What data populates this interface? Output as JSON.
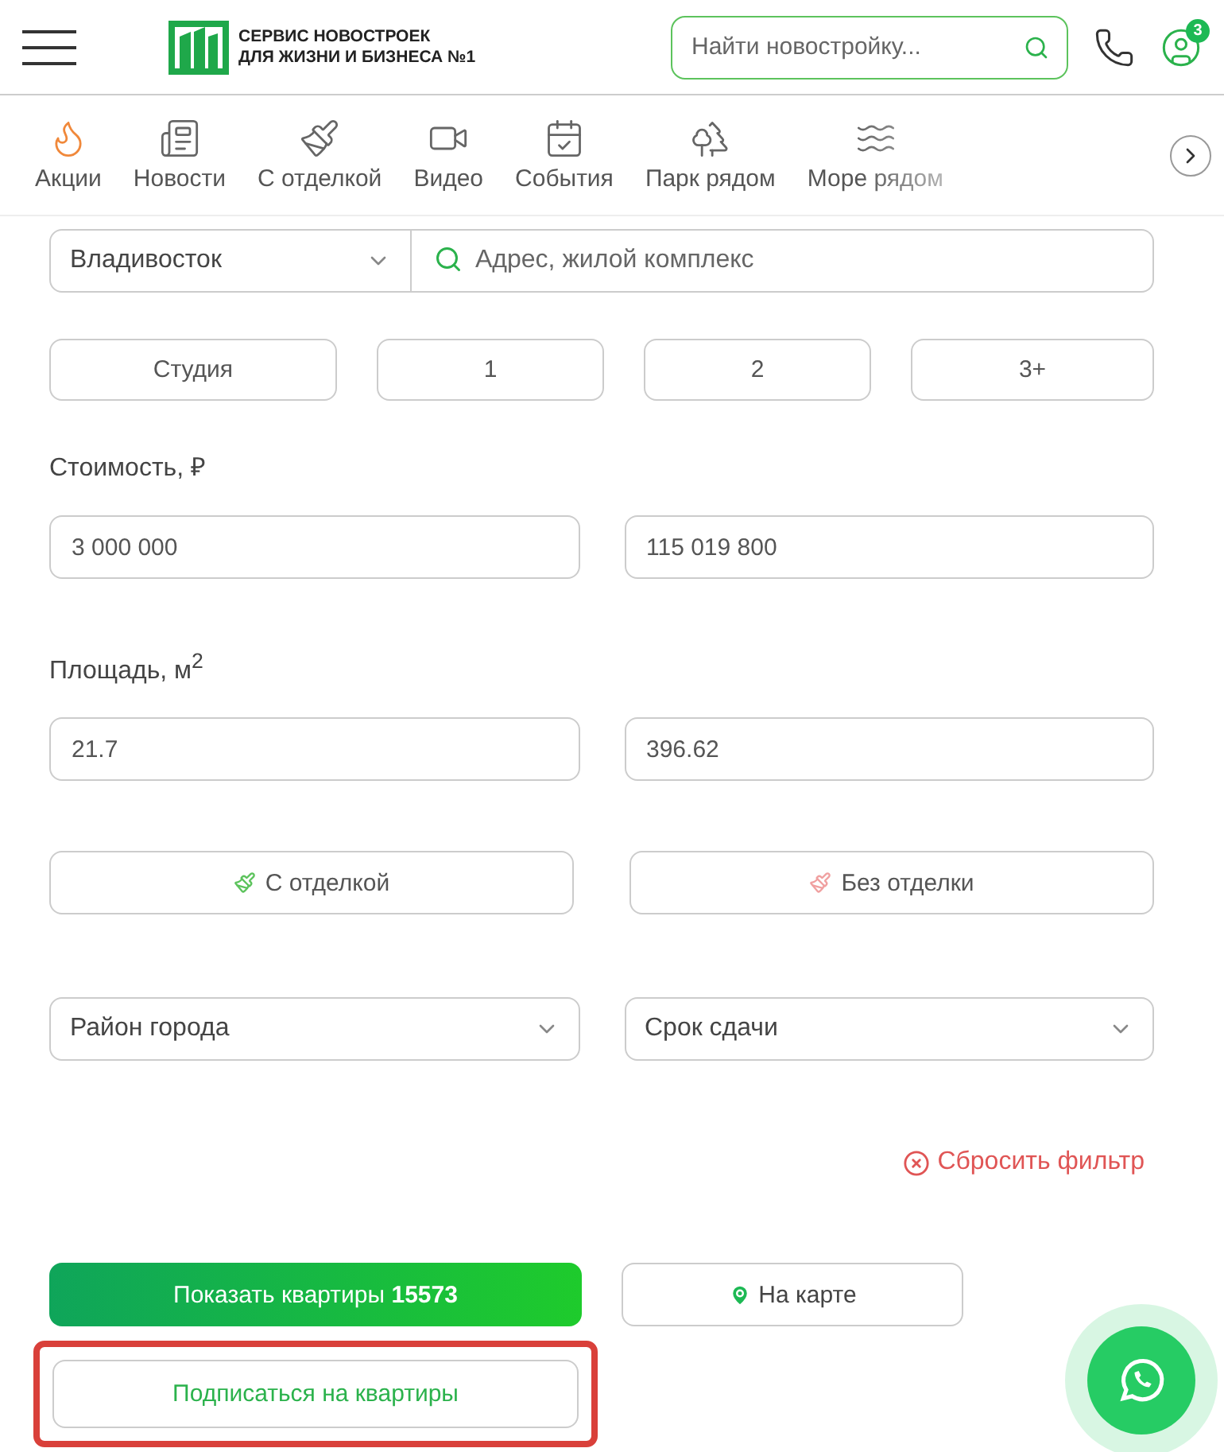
{
  "header": {
    "logo_text": [
      "СЕРВИС НОВОСТРОЕК",
      "ДЛЯ ЖИЗНИ И БИЗНЕСА №1"
    ],
    "search": {
      "placeholder": "Найти новостройку..."
    },
    "profile_badge": "3"
  },
  "categories": [
    {
      "label": "Акции",
      "kind": "flame"
    },
    {
      "label": "Новости",
      "kind": "news"
    },
    {
      "label": "С отделкой",
      "kind": "brush"
    },
    {
      "label": "Видео",
      "kind": "video"
    },
    {
      "label": "События",
      "kind": "calendar"
    },
    {
      "label": "Парк рядом",
      "kind": "park"
    },
    {
      "label": "Море рядом",
      "kind": "sea"
    }
  ],
  "filter": {
    "city": "Владивосток",
    "address": {
      "placeholder": "Адрес, жилой комплекс"
    },
    "rooms": [
      {
        "label": "Студия",
        "selected": false
      },
      {
        "label": "1",
        "selected": false
      },
      {
        "label": "2",
        "selected": false
      },
      {
        "label": "3+",
        "selected": false
      }
    ],
    "price_label": "Стоимость, ₽",
    "price_from": "3 000 000",
    "price_to": "115 019 800",
    "area_label": "Площадь, м$^{2}$",
    "area_from": "21.7",
    "area_to": "396.62",
    "finish": [
      {
        "label": "С отделкой",
        "kind": "with",
        "selected": false
      },
      {
        "label": "Без отделки",
        "kind": "without",
        "selected": false
      }
    ],
    "selects": [
      "Район города",
      "Срок сдачи"
    ],
    "reset": "Сбросить фильтр",
    "show_button": "Показать квартиры **15573**",
    "map_button": "На карте",
    "subscribe": {
      "label": "Подписаться на квартиры",
      "highlighted": true
    }
  }
}
